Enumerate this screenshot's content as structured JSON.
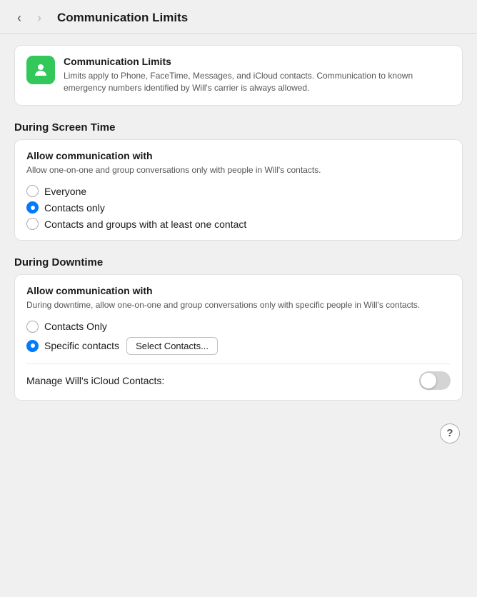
{
  "nav": {
    "back_arrow": "‹",
    "forward_arrow": "›",
    "title": "Communication Limits"
  },
  "info_card": {
    "title": "Communication Limits",
    "description": "Limits apply to Phone, FaceTime, Messages, and iCloud contacts. Communication to known emergency numbers identified by Will's carrier is always allowed.",
    "icon_name": "communication-limits-icon"
  },
  "screen_time_section": {
    "heading": "During Screen Time",
    "panel_title": "Allow communication with",
    "panel_desc": "Allow one-on-one and group conversations only with people in Will's contacts.",
    "options": [
      {
        "label": "Everyone",
        "selected": false
      },
      {
        "label": "Contacts only",
        "selected": true
      },
      {
        "label": "Contacts and groups with at least one contact",
        "selected": false
      }
    ]
  },
  "downtime_section": {
    "heading": "During Downtime",
    "panel_title": "Allow communication with",
    "panel_desc": "During downtime, allow one-on-one and group conversations only with specific people in Will's contacts.",
    "options": [
      {
        "label": "Contacts Only",
        "selected": false
      },
      {
        "label": "Specific contacts",
        "selected": true
      }
    ],
    "select_contacts_btn_label": "Select Contacts...",
    "manage_label": "Manage Will's iCloud Contacts:",
    "toggle_on": false
  },
  "help_btn_label": "?"
}
